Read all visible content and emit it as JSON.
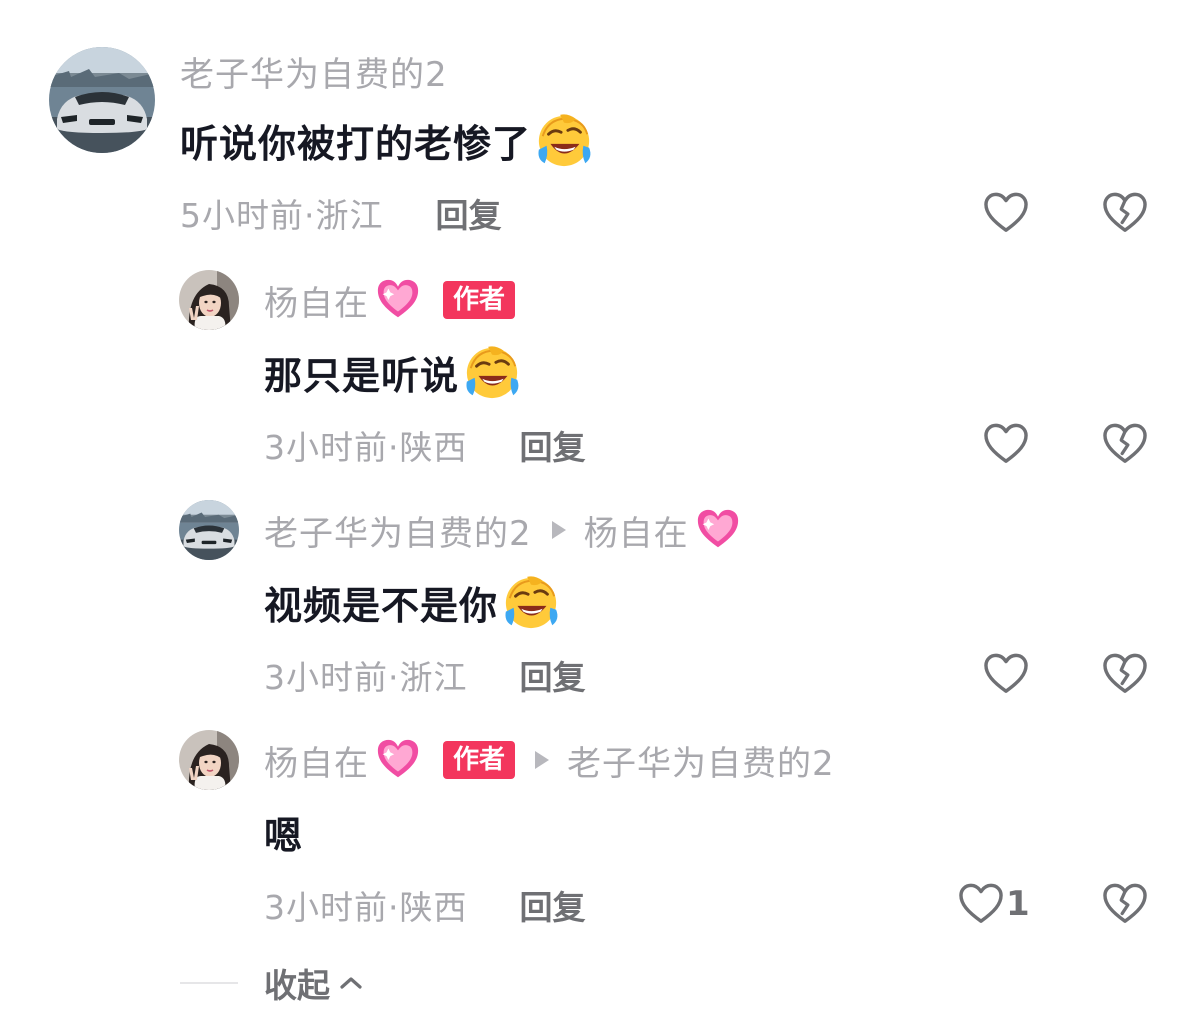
{
  "comments": [
    {
      "username": "老子华为自费的2",
      "text": "听说你被打的老惨了",
      "emoji": "crying-laughing-emoji",
      "time_location": "5小时前·浙江",
      "reply_label": "回复"
    },
    {
      "username": "杨自在",
      "badge": "作者",
      "text": "那只是听说",
      "emoji": "crying-laughing-emoji",
      "time_location": "3小时前·陕西",
      "reply_label": "回复"
    },
    {
      "username": "老子华为自费的2",
      "reply_to": "杨自在",
      "text": "视频是不是你",
      "emoji": "crying-laughing-emoji",
      "time_location": "3小时前·浙江",
      "reply_label": "回复"
    },
    {
      "username": "杨自在",
      "badge": "作者",
      "reply_to": "老子华为自费的2",
      "text": "嗯",
      "time_location": "3小时前·陕西",
      "reply_label": "回复",
      "like_count": "1"
    }
  ],
  "collapse_label": "收起",
  "icons": {
    "like": "heart-outline-icon",
    "dislike": "broken-heart-icon",
    "heart_emoji": "sparkling-heart-emoji",
    "collapse": "chevron-up-icon"
  },
  "colors": {
    "badge": "#f3365d",
    "text_primary": "#161823",
    "text_secondary": "#a8a8ad",
    "reply": "#6f7074"
  }
}
